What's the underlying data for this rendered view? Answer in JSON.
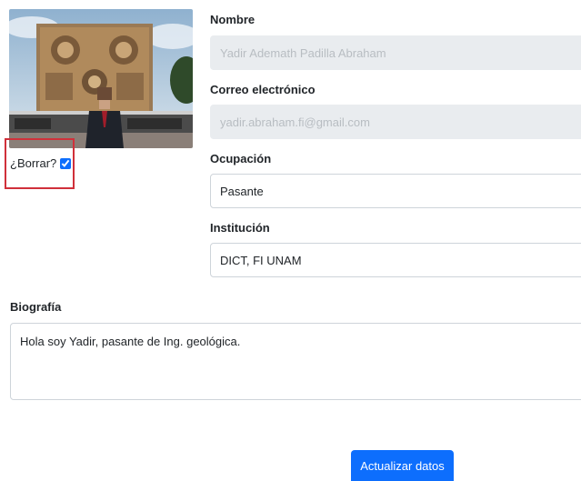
{
  "profile_photo": {
    "delete_label": "¿Borrar?",
    "delete_checked": true
  },
  "form": {
    "nombre": {
      "label": "Nombre",
      "value": "Yadir Ademath Padilla Abraham"
    },
    "correo": {
      "label": "Correo electrónico",
      "value": "yadir.abraham.fi@gmail.com"
    },
    "ocupacion": {
      "label": "Ocupación",
      "value": "Pasante"
    },
    "institucion": {
      "label": "Institución",
      "value": "DICT, FI UNAM"
    },
    "biografia": {
      "label": "Biografía",
      "value": "Hola soy Yadir, pasante de Ing. geológica."
    }
  },
  "submit_label": "Actualizar datos",
  "colors": {
    "primary": "#0d6efd",
    "highlight_border": "#d0303a",
    "disabled_bg": "#e9ecef"
  }
}
